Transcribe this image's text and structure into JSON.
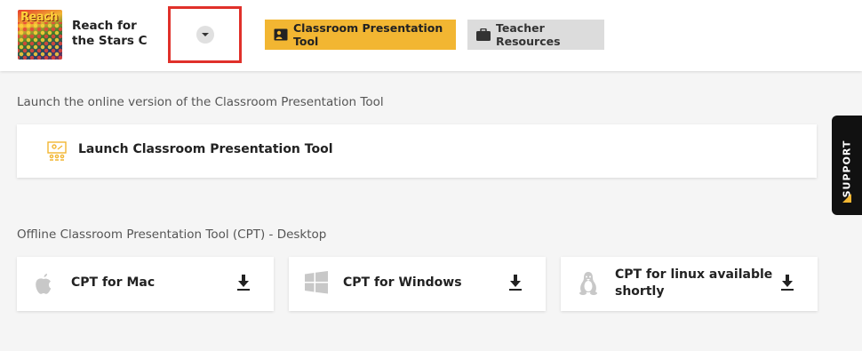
{
  "header": {
    "book_cover_text": "Reach",
    "book_title": "Reach for the Stars C",
    "tabs": [
      {
        "label": "Classroom Presentation Tool",
        "active": true,
        "icon": "presenter-icon"
      },
      {
        "label": "Teacher Resources",
        "active": false,
        "icon": "briefcase-icon"
      }
    ]
  },
  "online": {
    "section_label": "Launch the online version of the Classroom Presentation Tool",
    "launch_label": "Launch Classroom Presentation Tool",
    "icon": "classroom-presentation-icon"
  },
  "offline": {
    "section_label": "Offline Classroom Presentation Tool (CPT) - Desktop",
    "downloads": [
      {
        "label": "CPT for Mac",
        "icon": "apple-icon"
      },
      {
        "label": "CPT for Windows",
        "icon": "windows-icon"
      },
      {
        "label": "CPT for linux available shortly",
        "icon": "linux-icon"
      }
    ]
  },
  "support": {
    "label": "SUPPORT"
  },
  "colors": {
    "accent": "#f2b632",
    "highlight_box": "#e0302a",
    "support_bg": "#111111"
  }
}
